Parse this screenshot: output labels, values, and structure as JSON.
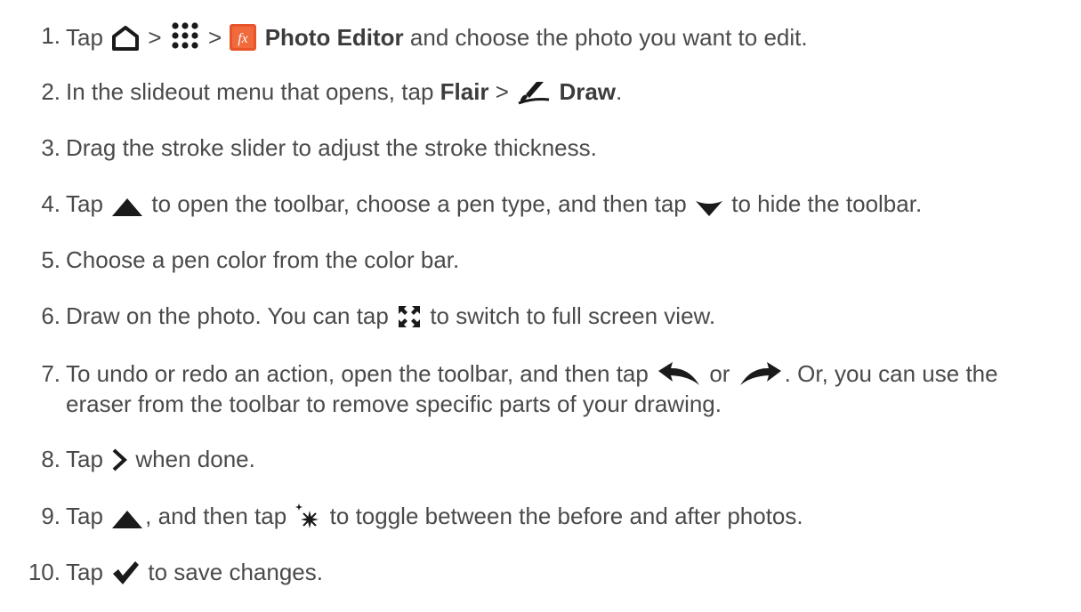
{
  "steps": [
    {
      "num": "1.",
      "parts": {
        "a": "Tap",
        "b": ">",
        "c": ">",
        "d": "Photo Editor",
        "e": "and choose the photo you want to edit."
      },
      "icons": [
        "home-icon",
        "apps-grid-icon",
        "photo-editor-fx-icon"
      ]
    },
    {
      "num": "2.",
      "parts": {
        "a": "In the slideout menu that opens, tap",
        "b": "Flair",
        "c": ">",
        "d": "Draw",
        "e": "."
      },
      "icons": [
        "draw-brush-icon"
      ]
    },
    {
      "num": "3.",
      "parts": {
        "a": "Drag the stroke slider to adjust the stroke thickness."
      }
    },
    {
      "num": "4.",
      "parts": {
        "a": "Tap",
        "b": "to open the toolbar, choose a pen type, and then tap",
        "c": "to hide the toolbar."
      },
      "icons": [
        "triangle-up-icon",
        "triangle-down-icon"
      ]
    },
    {
      "num": "5.",
      "parts": {
        "a": "Choose a pen color from the color bar."
      }
    },
    {
      "num": "6.",
      "parts": {
        "a": "Draw on the photo. You can tap",
        "b": "to switch to full screen view."
      },
      "icons": [
        "fullscreen-icon"
      ]
    },
    {
      "num": "7.",
      "parts": {
        "a": "To undo or redo an action, open the toolbar, and then tap",
        "b": "or",
        "c": ". Or, you can use the",
        "d": "eraser from the toolbar to remove specific parts of your drawing."
      },
      "icons": [
        "undo-icon",
        "redo-icon"
      ]
    },
    {
      "num": "8.",
      "parts": {
        "a": "Tap",
        "b": "when done."
      },
      "icons": [
        "chevron-right-icon"
      ]
    },
    {
      "num": "9.",
      "parts": {
        "a": "Tap",
        "b": ", and then tap",
        "c": "to toggle between the before and after photos."
      },
      "icons": [
        "triangle-up-icon",
        "sparkle-icon"
      ]
    },
    {
      "num": "10.",
      "parts": {
        "a": "Tap",
        "b": "to save changes."
      },
      "icons": [
        "checkmark-icon"
      ]
    }
  ],
  "colors": {
    "text": "#4a4a4a",
    "icon": "#1a1a1a",
    "fx_badge": "#e8552a"
  }
}
